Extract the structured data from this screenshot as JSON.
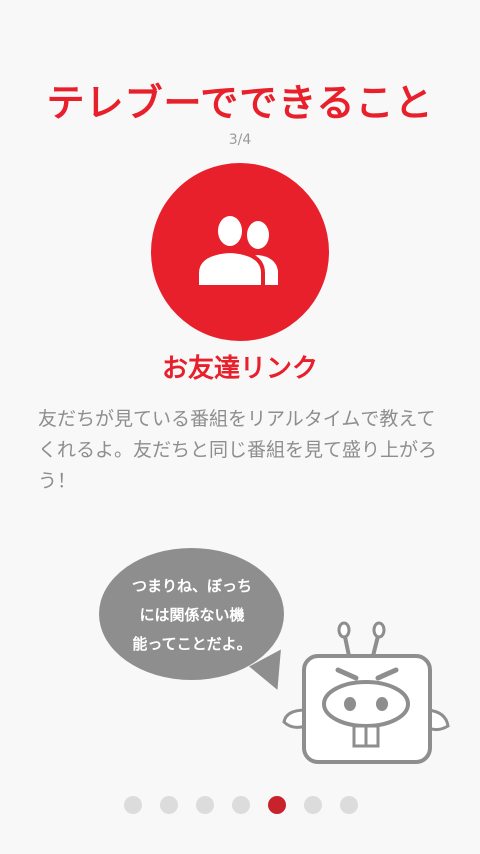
{
  "onboarding": {
    "title": "テレブーでできること",
    "page_indicator": "3/4",
    "feature_icon": "friends-icon",
    "feature_name": "お友達リンク",
    "description": "友だちが見ている番組をリアルタイムで教えてくれるよ。友だちと同じ番組を見て盛り上がろう！"
  },
  "speech_bubble": {
    "line1": "つまりね、ぼっち",
    "line2": "には関係ない機",
    "line3": "能ってことだよ。"
  },
  "pagination": {
    "total": 7,
    "active_index": 4
  },
  "colors": {
    "accent": "#e8202b",
    "active_dot": "#c8222c",
    "inactive_dot": "#dcdcdc",
    "bubble": "#8e8e8e",
    "body_text": "#8e8e8e"
  }
}
